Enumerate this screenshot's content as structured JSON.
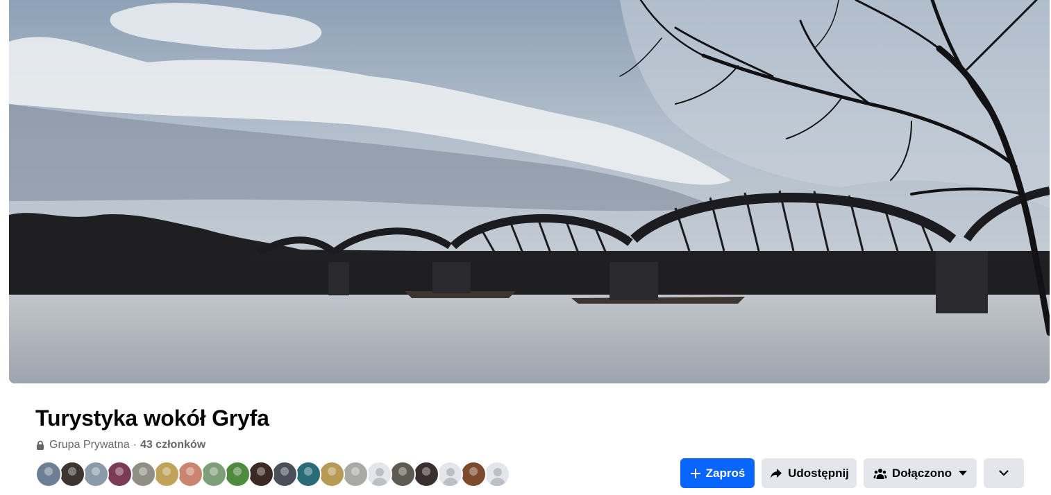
{
  "group": {
    "title": "Turystyka wokół Gryfa",
    "privacy": "Grupa Prywatna",
    "separator": "·",
    "members": "43 członków"
  },
  "cover": {
    "description_icon": "river-bridge-photo"
  },
  "member_avatars": [
    {
      "name": "avatar-1",
      "color": "#6d7f94"
    },
    {
      "name": "avatar-2",
      "color": "#3e3431"
    },
    {
      "name": "avatar-3",
      "color": "#8a9aa8"
    },
    {
      "name": "avatar-4",
      "color": "#7a3b55"
    },
    {
      "name": "avatar-5",
      "color": "#8f8f86"
    },
    {
      "name": "avatar-6",
      "color": "#c0a35a"
    },
    {
      "name": "avatar-7",
      "color": "#c9856f"
    },
    {
      "name": "avatar-8",
      "color": "#7f9e7a"
    },
    {
      "name": "avatar-9",
      "color": "#4f8a3e"
    },
    {
      "name": "avatar-10",
      "color": "#3b2a24"
    },
    {
      "name": "avatar-11",
      "color": "#4b4f5a"
    },
    {
      "name": "avatar-12",
      "color": "#2a6b78"
    },
    {
      "name": "avatar-13",
      "color": "#b89a57"
    },
    {
      "name": "avatar-14",
      "color": "#a9a9a6"
    },
    {
      "name": "avatar-default-1",
      "color": "default"
    },
    {
      "name": "avatar-16",
      "color": "#5e5b53"
    },
    {
      "name": "avatar-17",
      "color": "#3a2f30"
    },
    {
      "name": "avatar-default-2",
      "color": "default"
    },
    {
      "name": "avatar-19",
      "color": "#7d4a2e"
    },
    {
      "name": "avatar-default-3",
      "color": "default"
    }
  ],
  "actions": {
    "invite": "Zaproś",
    "share": "Udostępnij",
    "joined": "Dołączono"
  },
  "colors": {
    "primary": "#0866ff",
    "secondary_button": "#e4e6eb",
    "secondary_text": "#65676b"
  }
}
